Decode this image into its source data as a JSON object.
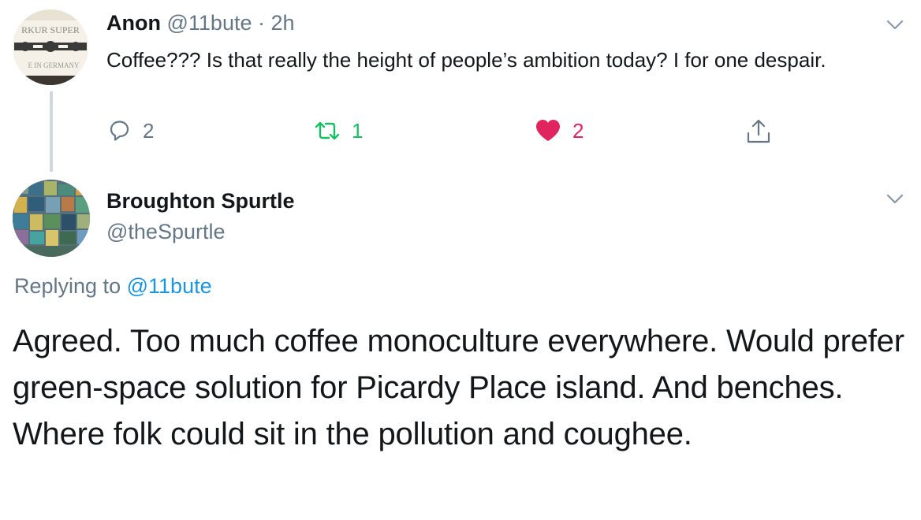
{
  "parent_tweet": {
    "avatar_text_top": "RKUR SUPER",
    "avatar_text_bottom": "E IN GERMANY",
    "display_name": "Anon",
    "handle": "@11bute",
    "separator": "·",
    "time": "2h",
    "text": "Coffee??? Is that really the height of people’s ambition today? I for one despair.",
    "reply_count": "2",
    "retweet_count": "1",
    "like_count": "2",
    "colors": {
      "retweet": "#17bf63",
      "like": "#e0245e",
      "muted": "#657786"
    }
  },
  "main_tweet": {
    "display_name": "Broughton Spurtle",
    "handle": "@theSpurtle",
    "replying_prefix": "Replying to",
    "replying_to": "@11bute",
    "text": "Agreed. Too much coffee monoculture everywhere. Would prefer green-space solution for Picardy Place island. And benches. Where folk could sit in the pollution and coughee.",
    "colors": {
      "link": "#1b95e0"
    }
  },
  "icons": {
    "caret": "chevron-down-icon",
    "reply": "reply-icon",
    "retweet": "retweet-icon",
    "like": "heart-icon",
    "share": "share-icon"
  }
}
